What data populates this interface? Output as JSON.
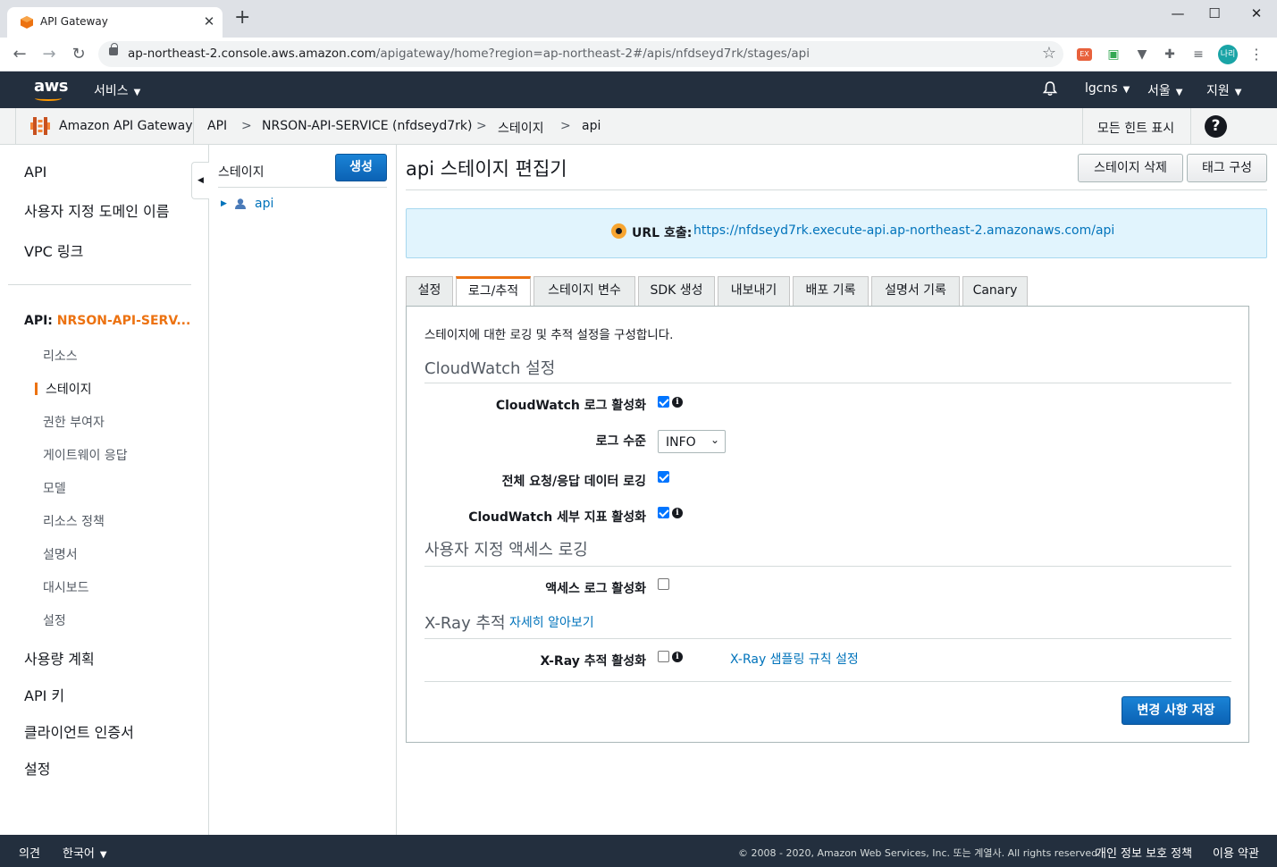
{
  "browser": {
    "tab_title": "API Gateway",
    "url_host": "ap-northeast-2.console.aws.amazon.com",
    "url_path": "/apigateway/home?region=ap-northeast-2#/apis/nfdseyd7rk/stages/api",
    "profile_label": "나리"
  },
  "awsnav": {
    "logo": "aws",
    "services": "서비스",
    "account": "lgcns",
    "region": "서울",
    "support": "지원"
  },
  "subnav": {
    "service_name": "Amazon API Gateway",
    "breadcrumbs": [
      "API",
      "NRSON-API-SERVICE (nfdseyd7rk)",
      "스테이지",
      "api"
    ],
    "separator": ">",
    "hints": "모든 힌트 표시",
    "help": "?"
  },
  "sidebar": {
    "top_items": [
      "API",
      "사용자 지정 도메인 이름",
      "VPC 링크"
    ],
    "api_prefix": "API: ",
    "api_name": "NRSON-API-SERV...",
    "sub_items": [
      "리소스",
      "스테이지",
      "권한 부여자",
      "게이트웨이 응답",
      "모델",
      "리소스 정책",
      "설명서",
      "대시보드",
      "설정"
    ],
    "bottom_items": [
      "사용량 계획",
      "API 키",
      "클라이언트 인증서",
      "설정"
    ]
  },
  "tree": {
    "title": "스테이지",
    "create_button": "생성",
    "stage": "api"
  },
  "main": {
    "title": "api 스테이지 편집기",
    "delete_button": "스테이지 삭제",
    "tag_button": "태그 구성",
    "invoke_label": "URL 호출:",
    "invoke_url": "https://nfdseyd7rk.execute-api.ap-northeast-2.amazonaws.com/api",
    "tabs": [
      "설정",
      "로그/추적",
      "스테이지 변수",
      "SDK 생성",
      "내보내기",
      "배포 기록",
      "설명서 기록",
      "Canary"
    ],
    "active_tab": "로그/추적"
  },
  "logs": {
    "intro": "스테이지에 대한 로깅 및 추적 설정을 구성합니다.",
    "cloudwatch_title": "CloudWatch 설정",
    "cw_enable_label": "CloudWatch 로그 활성화",
    "cw_enable": true,
    "log_level_label": "로그 수준",
    "log_level": "INFO",
    "full_logging_label": "전체 요청/응답 데이터 로깅",
    "full_logging": true,
    "detailed_metrics_label": "CloudWatch 세부 지표 활성화",
    "detailed_metrics": true,
    "access_title": "사용자 지정 액세스 로깅",
    "access_enable_label": "액세스 로그 활성화",
    "access_enable": false,
    "xray_title": "X-Ray 추적",
    "xray_learn_more": "자세히 알아보기",
    "xray_enable_label": "X-Ray 추적 활성화",
    "xray_enable": false,
    "xray_sampling_link": "X-Ray 샘플링 규칙 설정",
    "save_button": "변경 사항 저장"
  },
  "footer": {
    "feedback": "의견",
    "language": "한국어",
    "copyright": "© 2008 - 2020, Amazon Web Services, Inc. 또는 계열사. All rights reserved.",
    "privacy": "개인 정보 보호 정책",
    "terms": "이용 약관"
  },
  "colors": {
    "aws_nav": "#232f3e",
    "accent_orange": "#ec7211",
    "link_blue": "#0073bb",
    "primary_button": "#0f6fc6",
    "info_box": "#e1f4fd"
  }
}
